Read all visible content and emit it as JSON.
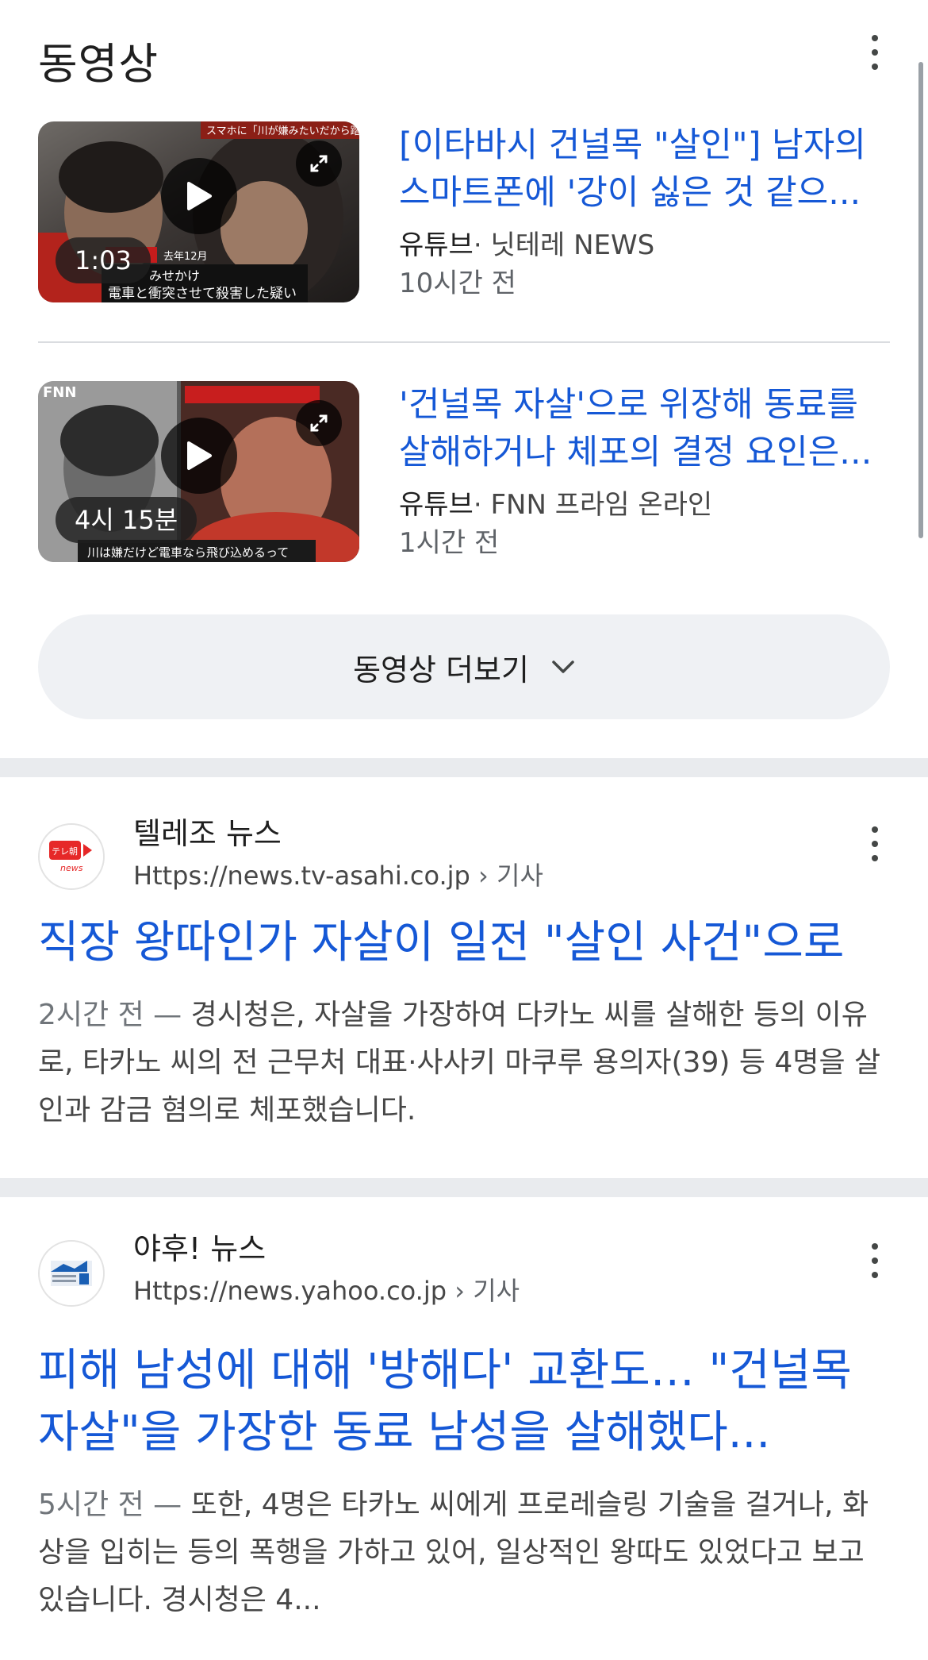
{
  "videos": {
    "title": "동영상",
    "items": [
      {
        "title_line1": "[이타바시 건널목 \"살인\"] 남자의",
        "title_line2": "스마트폰에 '강이 싫은 것 같으...",
        "platform": "유튜브",
        "channel": "· 닛테레 NEWS",
        "time": "10시간 전",
        "duration": "1:03",
        "thumb_caption_top": "スマホに「川が嫌みたいだから踏切に」",
        "thumb_caption_date": "去年12月",
        "thumb_caption_mid": "みせかけ",
        "thumb_caption_bottom": "電車と衝突させて殺害した疑い"
      },
      {
        "title_line1": "'건널목 자살'으로 위장해 동료를",
        "title_line2": "살해하거나 체포의 결정 요인은...",
        "platform": "유튜브",
        "channel": "· FNN 프라임 온라인",
        "time": "1시간 전",
        "duration": "4시 15분",
        "thumb_logo": "FNN",
        "thumb_caption_bottom": "川は嫌だけど電車なら飛び込めるって"
      }
    ],
    "more_label": "동영상 더보기"
  },
  "articles": [
    {
      "site_name": "텔레조 뉴스",
      "url": "Https://news.tv-asahi.co.jp",
      "crumb": " › 기사",
      "favicon_text": "テレ朝",
      "favicon_sub": "news",
      "title": "직장 왕따인가 자살이 일전 \"살인 사건\"으로",
      "date": "2시간 전 — ",
      "snippet": "경시청은, 자살을 가장하여 다카노 씨를 살해한 등의 이유로, 타카노 씨의 전 근무처 대표·사사키 마쿠루 용의자(39) 등 4명을 살인과 감금 혐의로 체포했습니다."
    },
    {
      "site_name": "야후! 뉴스",
      "url": "Https://news.yahoo.co.jp",
      "crumb": " › 기사",
      "title": "피해 남성에 대해 '방해다' 교환도… \"건널목 자살\"을 가장한 동료 남성을 살해했다...",
      "date": "5시간 전 — ",
      "snippet": "또한, 4명은 타카노 씨에게 프로레슬링 기술을 걸거나, 화상을 입히는 등의 폭행을 가하고 있어, 일상적인 왕따도 있었다고 보고 있습니다. 경시청은 4..."
    }
  ]
}
